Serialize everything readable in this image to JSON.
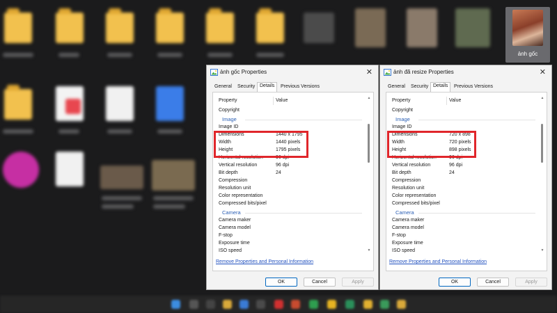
{
  "desktop": {
    "selected_label": "ảnh gốc"
  },
  "dialogs": [
    {
      "title": "ảnh gốc Properties",
      "tabs": [
        "General",
        "Security",
        "Details",
        "Previous Versions"
      ],
      "active_tab": "Details",
      "columns": [
        "Property",
        "Value"
      ],
      "rows": [
        {
          "kind": "prop",
          "property": "Copyright",
          "value": ""
        },
        {
          "kind": "group",
          "property": "Image"
        },
        {
          "kind": "prop",
          "property": "Image ID",
          "value": ""
        },
        {
          "kind": "prop",
          "property": "Dimensions",
          "value": "1440 x 1795"
        },
        {
          "kind": "prop",
          "property": "Width",
          "value": "1440 pixels"
        },
        {
          "kind": "prop",
          "property": "Height",
          "value": "1795 pixels"
        },
        {
          "kind": "prop",
          "property": "Horizontal resolution",
          "value": "96 dpi"
        },
        {
          "kind": "prop",
          "property": "Vertical resolution",
          "value": "96 dpi"
        },
        {
          "kind": "prop",
          "property": "Bit depth",
          "value": "24"
        },
        {
          "kind": "prop",
          "property": "Compression",
          "value": ""
        },
        {
          "kind": "prop",
          "property": "Resolution unit",
          "value": ""
        },
        {
          "kind": "prop",
          "property": "Color representation",
          "value": ""
        },
        {
          "kind": "prop",
          "property": "Compressed bits/pixel",
          "value": ""
        },
        {
          "kind": "group",
          "property": "Camera"
        },
        {
          "kind": "prop",
          "property": "Camera maker",
          "value": ""
        },
        {
          "kind": "prop",
          "property": "Camera model",
          "value": ""
        },
        {
          "kind": "prop",
          "property": "F-stop",
          "value": ""
        },
        {
          "kind": "prop",
          "property": "Exposure time",
          "value": ""
        },
        {
          "kind": "prop",
          "property": "ISO speed",
          "value": ""
        }
      ],
      "remove_link": "Remove Properties and Personal Information",
      "buttons": {
        "ok": "OK",
        "cancel": "Cancel",
        "apply": "Apply"
      },
      "highlight_color": "#e0262b"
    },
    {
      "title": "ảnh đã resize Properties",
      "tabs": [
        "General",
        "Security",
        "Details",
        "Previous Versions"
      ],
      "active_tab": "Details",
      "columns": [
        "Property",
        "Value"
      ],
      "rows": [
        {
          "kind": "prop",
          "property": "Copyright",
          "value": ""
        },
        {
          "kind": "group",
          "property": "Image"
        },
        {
          "kind": "prop",
          "property": "Image ID",
          "value": ""
        },
        {
          "kind": "prop",
          "property": "Dimensions",
          "value": "720 x 898"
        },
        {
          "kind": "prop",
          "property": "Width",
          "value": "720 pixels"
        },
        {
          "kind": "prop",
          "property": "Height",
          "value": "898 pixels"
        },
        {
          "kind": "prop",
          "property": "Horizontal resolution",
          "value": "96 dpi"
        },
        {
          "kind": "prop",
          "property": "Vertical resolution",
          "value": "96 dpi"
        },
        {
          "kind": "prop",
          "property": "Bit depth",
          "value": "24"
        },
        {
          "kind": "prop",
          "property": "Compression",
          "value": ""
        },
        {
          "kind": "prop",
          "property": "Resolution unit",
          "value": ""
        },
        {
          "kind": "prop",
          "property": "Color representation",
          "value": ""
        },
        {
          "kind": "prop",
          "property": "Compressed bits/pixel",
          "value": ""
        },
        {
          "kind": "group",
          "property": "Camera"
        },
        {
          "kind": "prop",
          "property": "Camera maker",
          "value": ""
        },
        {
          "kind": "prop",
          "property": "Camera model",
          "value": ""
        },
        {
          "kind": "prop",
          "property": "F-stop",
          "value": ""
        },
        {
          "kind": "prop",
          "property": "Exposure time",
          "value": ""
        },
        {
          "kind": "prop",
          "property": "ISO speed",
          "value": ""
        }
      ],
      "remove_link": "Remove Properties and Personal Information",
      "buttons": {
        "ok": "OK",
        "cancel": "Cancel",
        "apply": "Apply"
      },
      "highlight_color": "#e0262b"
    }
  ]
}
